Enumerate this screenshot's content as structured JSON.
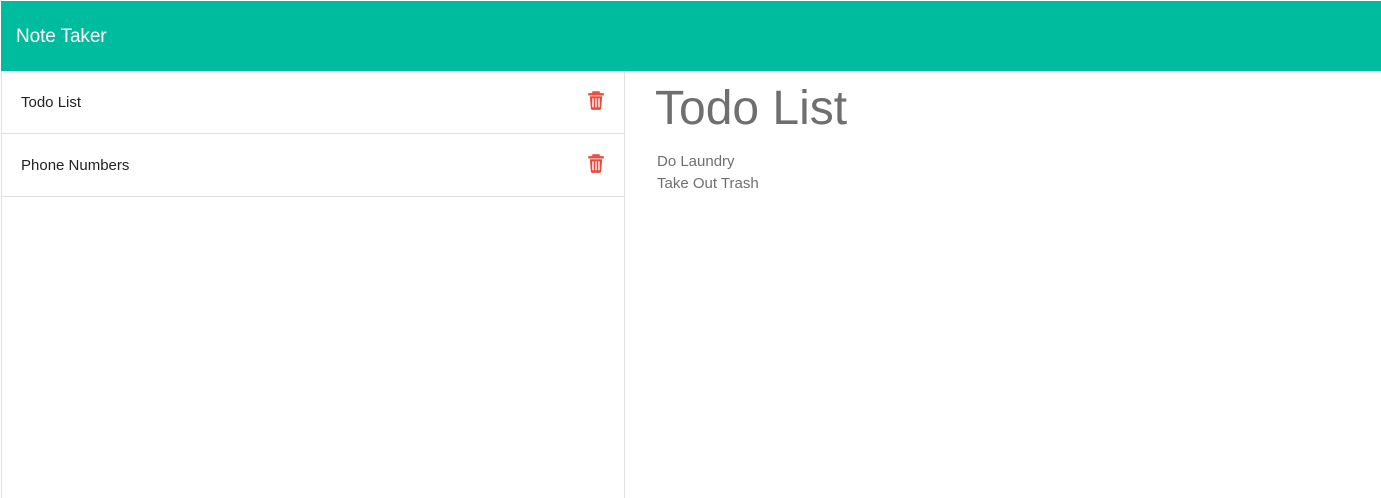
{
  "app": {
    "brand": "Note Taker"
  },
  "notes": [
    {
      "title": "Todo List"
    },
    {
      "title": "Phone Numbers"
    }
  ],
  "active_note": {
    "title": "Todo List",
    "body_lines": [
      "Do Laundry",
      "Take Out Trash"
    ]
  },
  "icons": {
    "delete": "trash-icon"
  },
  "colors": {
    "navbar": "#00bc9f",
    "brand_text": "#ffffff",
    "delete_icon": "#e84c3d",
    "note_text": "#6f6f6f"
  }
}
